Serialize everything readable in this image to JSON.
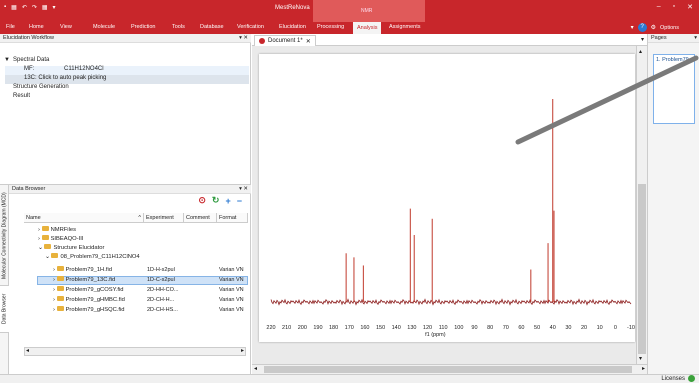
{
  "window": {
    "title": "MestReNova",
    "context_tab": "NMR",
    "quick_access": [
      "▪",
      "▦",
      "↶",
      "↷",
      "▦",
      "▾"
    ]
  },
  "menu": {
    "items": [
      "File",
      "Home",
      "View",
      "Molecule",
      "Prediction",
      "Tools",
      "Database",
      "Verification",
      "Elucidation",
      "Processing",
      "Analysis",
      "Assignments"
    ],
    "active": "Analysis",
    "options_label": "Options"
  },
  "workflow": {
    "title": "Elucidation Workflow",
    "spectral_data": "Spectral Data",
    "mf_label": "MF:",
    "mf_value": "C11H12NO4Cl",
    "c13_item": "13C: Click to auto peak picking",
    "structure_generation": "Structure Generation",
    "result": "Result"
  },
  "browser": {
    "title": "Data Browser",
    "side_tabs": [
      "Molecular Connectivity Diagram (MCD)",
      "Data Browser"
    ],
    "columns": [
      "Name",
      "Experiment",
      "Comment",
      "Format"
    ],
    "tree": [
      {
        "label": "NMRFiles",
        "indent": 0,
        "expander": ">"
      },
      {
        "label": "SIBEAQO-III",
        "indent": 0,
        "expander": ">"
      },
      {
        "label": "Structure Elucidator",
        "indent": 0,
        "expander": "v"
      },
      {
        "label": "08_Problem79_C11H12ClNO4",
        "indent": 1,
        "expander": "v"
      }
    ],
    "files": [
      {
        "name": "Problem79_1H.fid",
        "experiment": "1D-H-s2pul",
        "format": "Varian VN"
      },
      {
        "name": "Problem79_13C.fid",
        "experiment": "1D-C-s2pul",
        "format": "Varian VN",
        "selected": true
      },
      {
        "name": "Problem79_gCOSY.fid",
        "experiment": "2D-HH-CO...",
        "format": "Varian VN"
      },
      {
        "name": "Problem79_gHMBC.fid",
        "experiment": "2D-CH-H...",
        "format": "Varian VN"
      },
      {
        "name": "Problem79_gHSQC.fid",
        "experiment": "2D-CH-HS...",
        "format": "Varian VN"
      }
    ]
  },
  "document": {
    "tab_label": "Document 1*"
  },
  "spectrum": {
    "axis_ticks": [
      "220",
      "210",
      "200",
      "190",
      "180",
      "170",
      "160",
      "150",
      "140",
      "130",
      "120",
      "110",
      "100",
      "90",
      "80",
      "70",
      "60",
      "50",
      "40",
      "30",
      "20",
      "10",
      "0",
      "-10"
    ],
    "axis_label": "f1 (ppm)",
    "peaks_ppm": [
      172.0,
      167.0,
      161.0,
      131.0,
      128.5,
      117.0,
      54.0,
      43.0,
      40.0,
      39.2
    ],
    "peaks_height": [
      0.24,
      0.22,
      0.18,
      0.46,
      0.33,
      0.41,
      0.16,
      0.29,
      1.0,
      0.45
    ]
  },
  "pages": {
    "title": "Pages",
    "thumb_label": "1. Problem79"
  },
  "status": {
    "label": "Licenses"
  }
}
